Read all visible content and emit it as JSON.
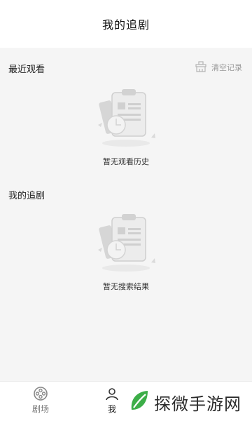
{
  "header": {
    "title": "我的追剧"
  },
  "recent": {
    "title": "最近观看",
    "clear_label": "清空记录",
    "empty_text": "暂无观看历史"
  },
  "following": {
    "title": "我的追剧",
    "empty_text": "暂无搜索结果"
  },
  "tabbar": {
    "items": [
      {
        "label": "剧场",
        "icon": "film-reel-icon"
      },
      {
        "label": "我",
        "icon": "user-icon"
      }
    ]
  },
  "watermark": {
    "text": "探微手游网",
    "icon": "leaf-logo"
  }
}
